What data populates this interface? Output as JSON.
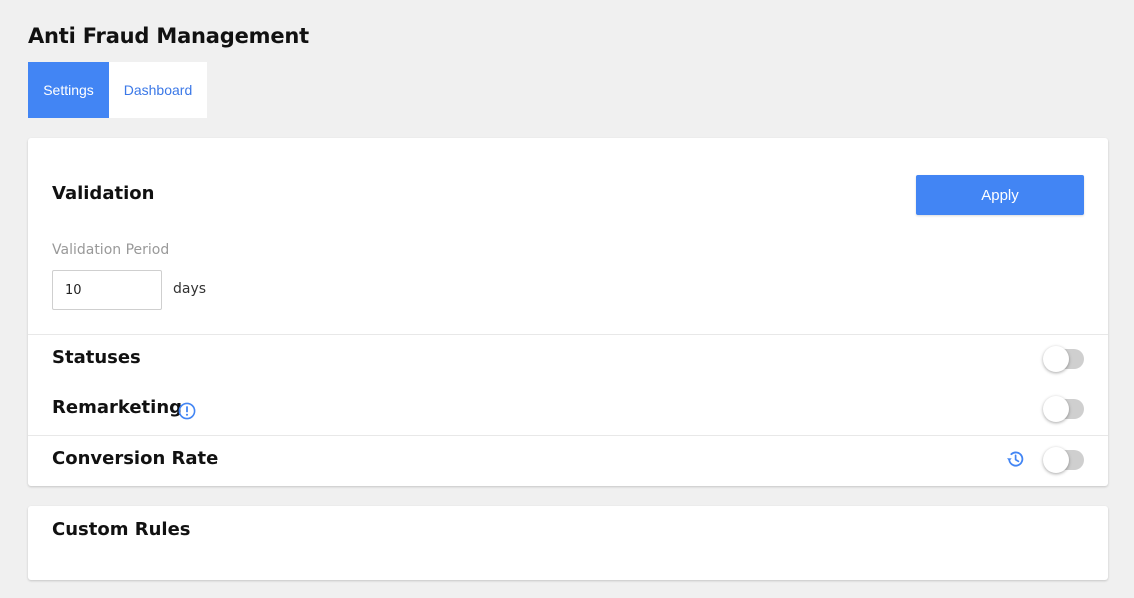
{
  "page": {
    "title": "Anti Fraud Management"
  },
  "tabs": [
    {
      "label": "Settings",
      "active": true
    },
    {
      "label": "Dashboard",
      "active": false
    }
  ],
  "validation": {
    "title": "Validation",
    "apply_label": "Apply",
    "period_label": "Validation Period",
    "period_value": "10",
    "period_unit": "days"
  },
  "statuses": {
    "label": "Statuses",
    "enabled": false
  },
  "remarketing": {
    "label": "Remarketing",
    "enabled": false,
    "icon": "info-icon"
  },
  "conversion_rate": {
    "label": "Conversion Rate",
    "enabled": false,
    "icon": "history-icon"
  },
  "custom_rules": {
    "title": "Custom Rules"
  },
  "colors": {
    "accent": "#4285f4",
    "tab_link": "#3b78e7",
    "background": "#f0f0f0",
    "toggle_off": "#cfcfcf"
  }
}
